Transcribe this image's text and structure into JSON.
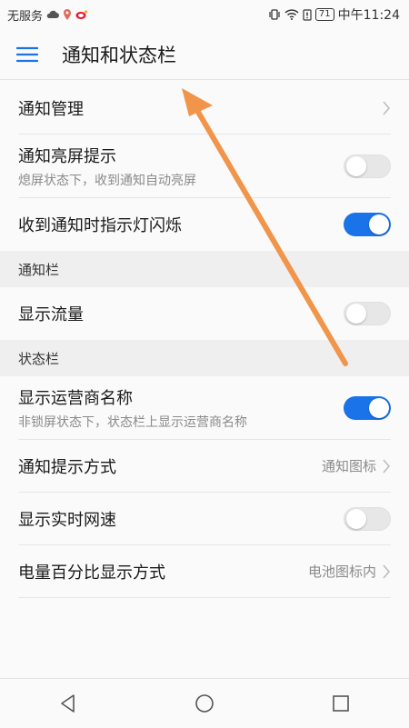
{
  "status_bar": {
    "left_text": "无服务",
    "battery": "71",
    "time": "中午11:24",
    "icons": [
      "cloud-icon",
      "location-pin-icon",
      "weibo-icon",
      "vibrate-icon",
      "wifi-icon",
      "alert-icon",
      "battery-icon"
    ]
  },
  "app_bar": {
    "title": "通知和状态栏",
    "icon": "hamburger-menu-icon"
  },
  "rows_top": {
    "notify_manage": {
      "title": "通知管理"
    },
    "notify_wake": {
      "title": "通知亮屏提示",
      "subtitle": "熄屏状态下，收到通知自动亮屏",
      "toggle": "off"
    },
    "notify_led": {
      "title": "收到通知时指示灯闪烁",
      "toggle": "on"
    }
  },
  "section_notification": {
    "header": "通知栏",
    "show_traffic": {
      "title": "显示流量",
      "toggle": "off"
    }
  },
  "section_status": {
    "header": "状态栏",
    "show_carrier": {
      "title": "显示运营商名称",
      "subtitle": "非锁屏状态下，状态栏上显示运营商名称",
      "toggle": "on"
    },
    "notify_style": {
      "title": "通知提示方式",
      "value": "通知图标"
    },
    "net_speed": {
      "title": "显示实时网速",
      "toggle": "off"
    },
    "battery_pct": {
      "title": "电量百分比显示方式",
      "value": "电池图标内"
    }
  },
  "nav_bar": {
    "icons": [
      "back-triangle-icon",
      "home-circle-icon",
      "recents-square-icon"
    ]
  },
  "colors": {
    "accent": "#1a73e8",
    "annotation_arrow": "#f0954a"
  }
}
